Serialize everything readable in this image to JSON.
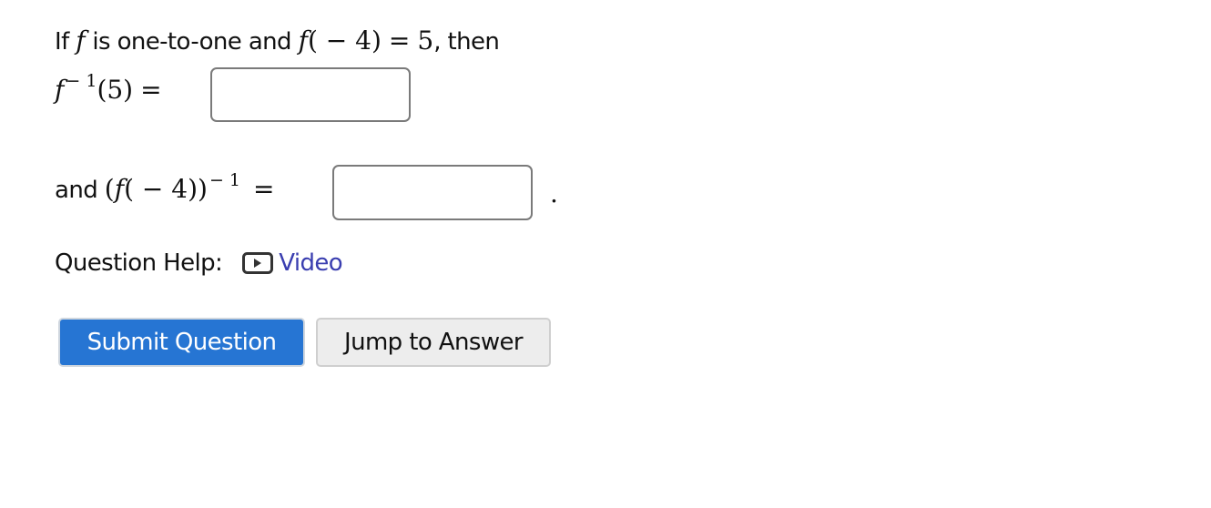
{
  "question": {
    "line1": {
      "prefix": "If ",
      "f_var": "f",
      "mid": " is one-to-one and ",
      "expr_f": "f",
      "expr_arg": "( − 4)",
      "equals": "=",
      "value": "5",
      "suffix": ", then"
    },
    "line2": {
      "f_var": "f",
      "exponent": "− 1",
      "arg": "(5)",
      "equals": "="
    },
    "line3": {
      "prefix": "and ",
      "open": "(",
      "f_var": "f",
      "arg": "( − 4))",
      "exponent": "− 1",
      "equals": "=",
      "trailing": "."
    },
    "inputs": [
      {
        "name": "f-inverse-of-5",
        "value": "",
        "placeholder": ""
      },
      {
        "name": "reciprocal-f-of-neg4",
        "value": "",
        "placeholder": ""
      }
    ]
  },
  "help": {
    "label": "Question Help:",
    "icon": "video-play-icon",
    "link_label": "Video"
  },
  "actions": {
    "submit_label": "Submit Question",
    "jump_label": "Jump to Answer"
  },
  "colors": {
    "primary_button": "#2675d3",
    "secondary_button": "#ededed",
    "link": "#3a3eb0",
    "input_border": "#7a7a7a"
  }
}
